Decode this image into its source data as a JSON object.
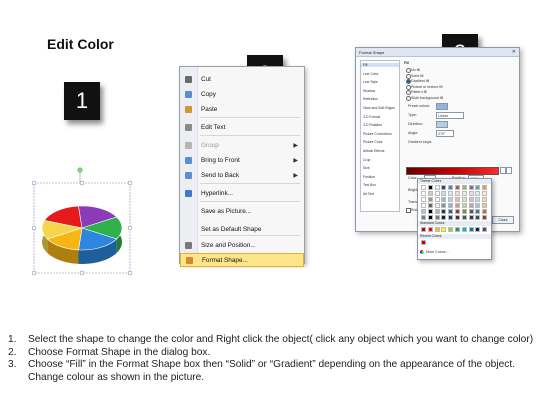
{
  "title": "Edit Color",
  "badges": [
    "1",
    "2",
    "3"
  ],
  "context_menu": {
    "items": [
      {
        "label": "Cut",
        "icon": "scissors-icon",
        "color": "#6b6b6b"
      },
      {
        "label": "Copy",
        "icon": "copy-icon",
        "color": "#5b8ed1"
      },
      {
        "label": "Paste",
        "icon": "paste-icon",
        "color": "#c99a3a"
      },
      {
        "label": "Edit Text",
        "icon": "edit-text-icon",
        "color": "#8a8a8a"
      },
      {
        "label": "Group",
        "icon": "group-icon",
        "color": "#b5b5b5",
        "disabled": true,
        "submenu": true
      },
      {
        "label": "Bring to Front",
        "icon": "bring-to-front-icon",
        "color": "#5b8ed1",
        "submenu": true
      },
      {
        "label": "Send to Back",
        "icon": "send-to-back-icon",
        "color": "#5b8ed1",
        "submenu": true
      },
      {
        "label": "Hyperlink...",
        "icon": "hyperlink-icon",
        "color": "#3d7ac9"
      },
      {
        "label": "Save as Picture...",
        "icon": "",
        "color": ""
      },
      {
        "label": "Set as Default Shape",
        "icon": "",
        "color": ""
      },
      {
        "label": "Size and Position...",
        "icon": "size-position-icon",
        "color": "#7a7a7a"
      },
      {
        "label": "Format Shape...",
        "icon": "format-shape-icon",
        "color": "#d08a2a",
        "highlighted": true
      }
    ]
  },
  "dialog": {
    "title": "Format Shape",
    "close": "✕",
    "nav": [
      "Fill",
      "Line Color",
      "Line Style",
      "Shadow",
      "Reflection",
      "Glow and Soft Edges",
      "3-D Format",
      "3-D Rotation",
      "Picture Corrections",
      "Picture Color",
      "Artistic Effects",
      "Crop",
      "Size",
      "Position",
      "Text Box",
      "Alt Text"
    ],
    "fill_heading": "Fill",
    "options": [
      "No fill",
      "Solid fill",
      "Gradient fill",
      "Picture or texture fill",
      "Pattern fill",
      "Slide background fill"
    ],
    "selected_option": 2,
    "preset_colors": "Preset colors:",
    "type_label": "Type:",
    "type_value": "Linear",
    "direction_label": "Direction:",
    "angle_label": "Angle:",
    "angle_value": "270°",
    "gradient_stops": "Gradient stops",
    "color_label": "Color",
    "position_label": "Position:",
    "position_value": "100%",
    "brightness_label": "Brightness:",
    "transparency_label": "Transparency:",
    "rotate_label": "Rotate with shape",
    "close_button": "Close"
  },
  "palette": {
    "theme_header": "Theme Colors",
    "standard_header": "Standard Colors",
    "recent_header": "Recent Colors",
    "more_colors": "More Colors...",
    "theme_top": [
      "#ffffff",
      "#000000",
      "#eeece1",
      "#1f497d",
      "#4f81bd",
      "#c0504d",
      "#9bbb59",
      "#8064a2",
      "#4bacc6",
      "#f79646"
    ],
    "standard": [
      "#c00000",
      "#ff0000",
      "#ffc000",
      "#ffff00",
      "#92d050",
      "#00b050",
      "#00b0f0",
      "#0070c0",
      "#002060",
      "#7030a0"
    ],
    "recent": [
      "#c00000"
    ]
  },
  "pie_colors": [
    "#e31b1b",
    "#f7b614",
    "#2e86de",
    "#2fb14a",
    "#8b3bb8",
    "#f4d64a"
  ],
  "instructions": [
    {
      "num": "1.",
      "text": "Select the shape to change the color and Right click the object( click any object which you want to change color)"
    },
    {
      "num": "2.",
      "text": "Choose Format Shape in the dialog box."
    },
    {
      "num": "3.",
      "text": "Choose “Fill” in the Format Shape box then “Solid” or “Gradient” depending on the appearance of the object. Change colour as shown in the picture."
    }
  ]
}
